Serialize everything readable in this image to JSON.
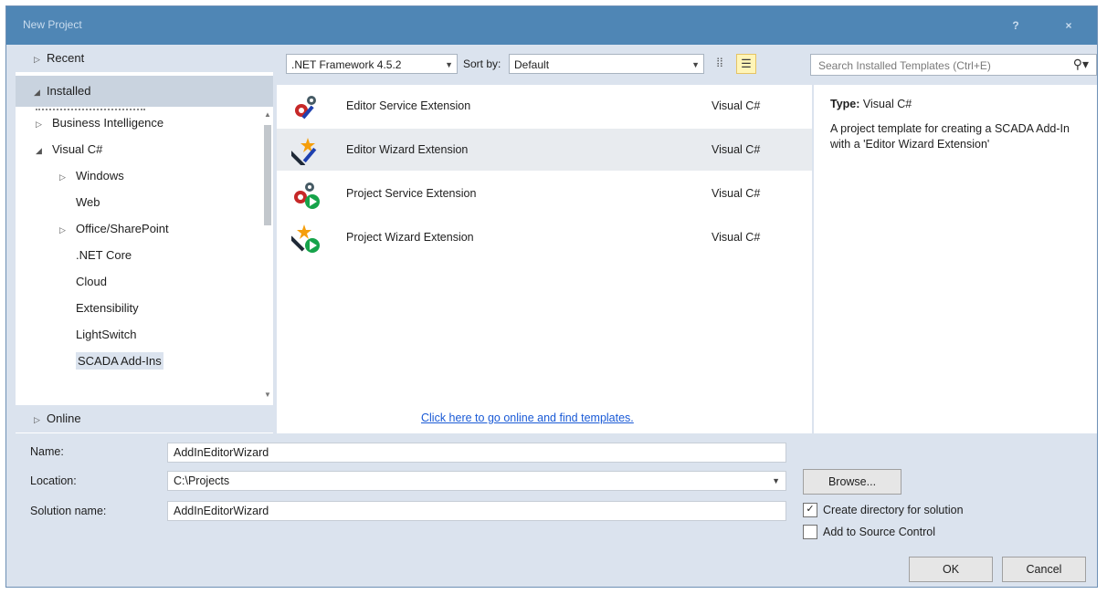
{
  "window": {
    "title": "New Project",
    "help": "?",
    "close": "×"
  },
  "nav": {
    "recent": "Recent",
    "installed": "Installed",
    "online": "Online",
    "tree": [
      {
        "label": "Business Intelligence",
        "expander": "▷"
      },
      {
        "label": "Visual C#",
        "expander": "◢"
      },
      {
        "label": "Windows",
        "expander": "▷"
      },
      {
        "label": "Web",
        "expander": ""
      },
      {
        "label": "Office/SharePoint",
        "expander": "▷"
      },
      {
        "label": ".NET Core",
        "expander": ""
      },
      {
        "label": "Cloud",
        "expander": ""
      },
      {
        "label": "Extensibility",
        "expander": ""
      },
      {
        "label": "LightSwitch",
        "expander": ""
      },
      {
        "label": "SCADA Add-Ins",
        "expander": "",
        "selected": true
      }
    ]
  },
  "toolbar": {
    "framework": ".NET Framework 4.5.2",
    "sort_label": "Sort by:",
    "sort_value": "Default",
    "search_placeholder": "Search Installed Templates (Ctrl+E)"
  },
  "templates": [
    {
      "name": "Editor Service Extension",
      "lang": "Visual C#"
    },
    {
      "name": "Editor Wizard Extension",
      "lang": "Visual C#",
      "selected": true
    },
    {
      "name": "Project Service Extension",
      "lang": "Visual C#"
    },
    {
      "name": "Project Wizard Extension",
      "lang": "Visual C#"
    }
  ],
  "online_link": "Click here to go online and find templates.",
  "details": {
    "type_label": "Type:",
    "type_value": "Visual C#",
    "description": "A project template for creating a SCADA Add-In with a 'Editor Wizard Extension'"
  },
  "form": {
    "name_label": "Name:",
    "name_value": "AddInEditorWizard",
    "location_label": "Location:",
    "location_value": "C:\\Projects",
    "solution_label": "Solution name:",
    "solution_value": "AddInEditorWizard",
    "browse": "Browse...",
    "create_dir": "Create directory for solution",
    "create_dir_checked": true,
    "source_control": "Add to Source Control",
    "source_control_checked": false,
    "ok": "OK",
    "cancel": "Cancel"
  }
}
